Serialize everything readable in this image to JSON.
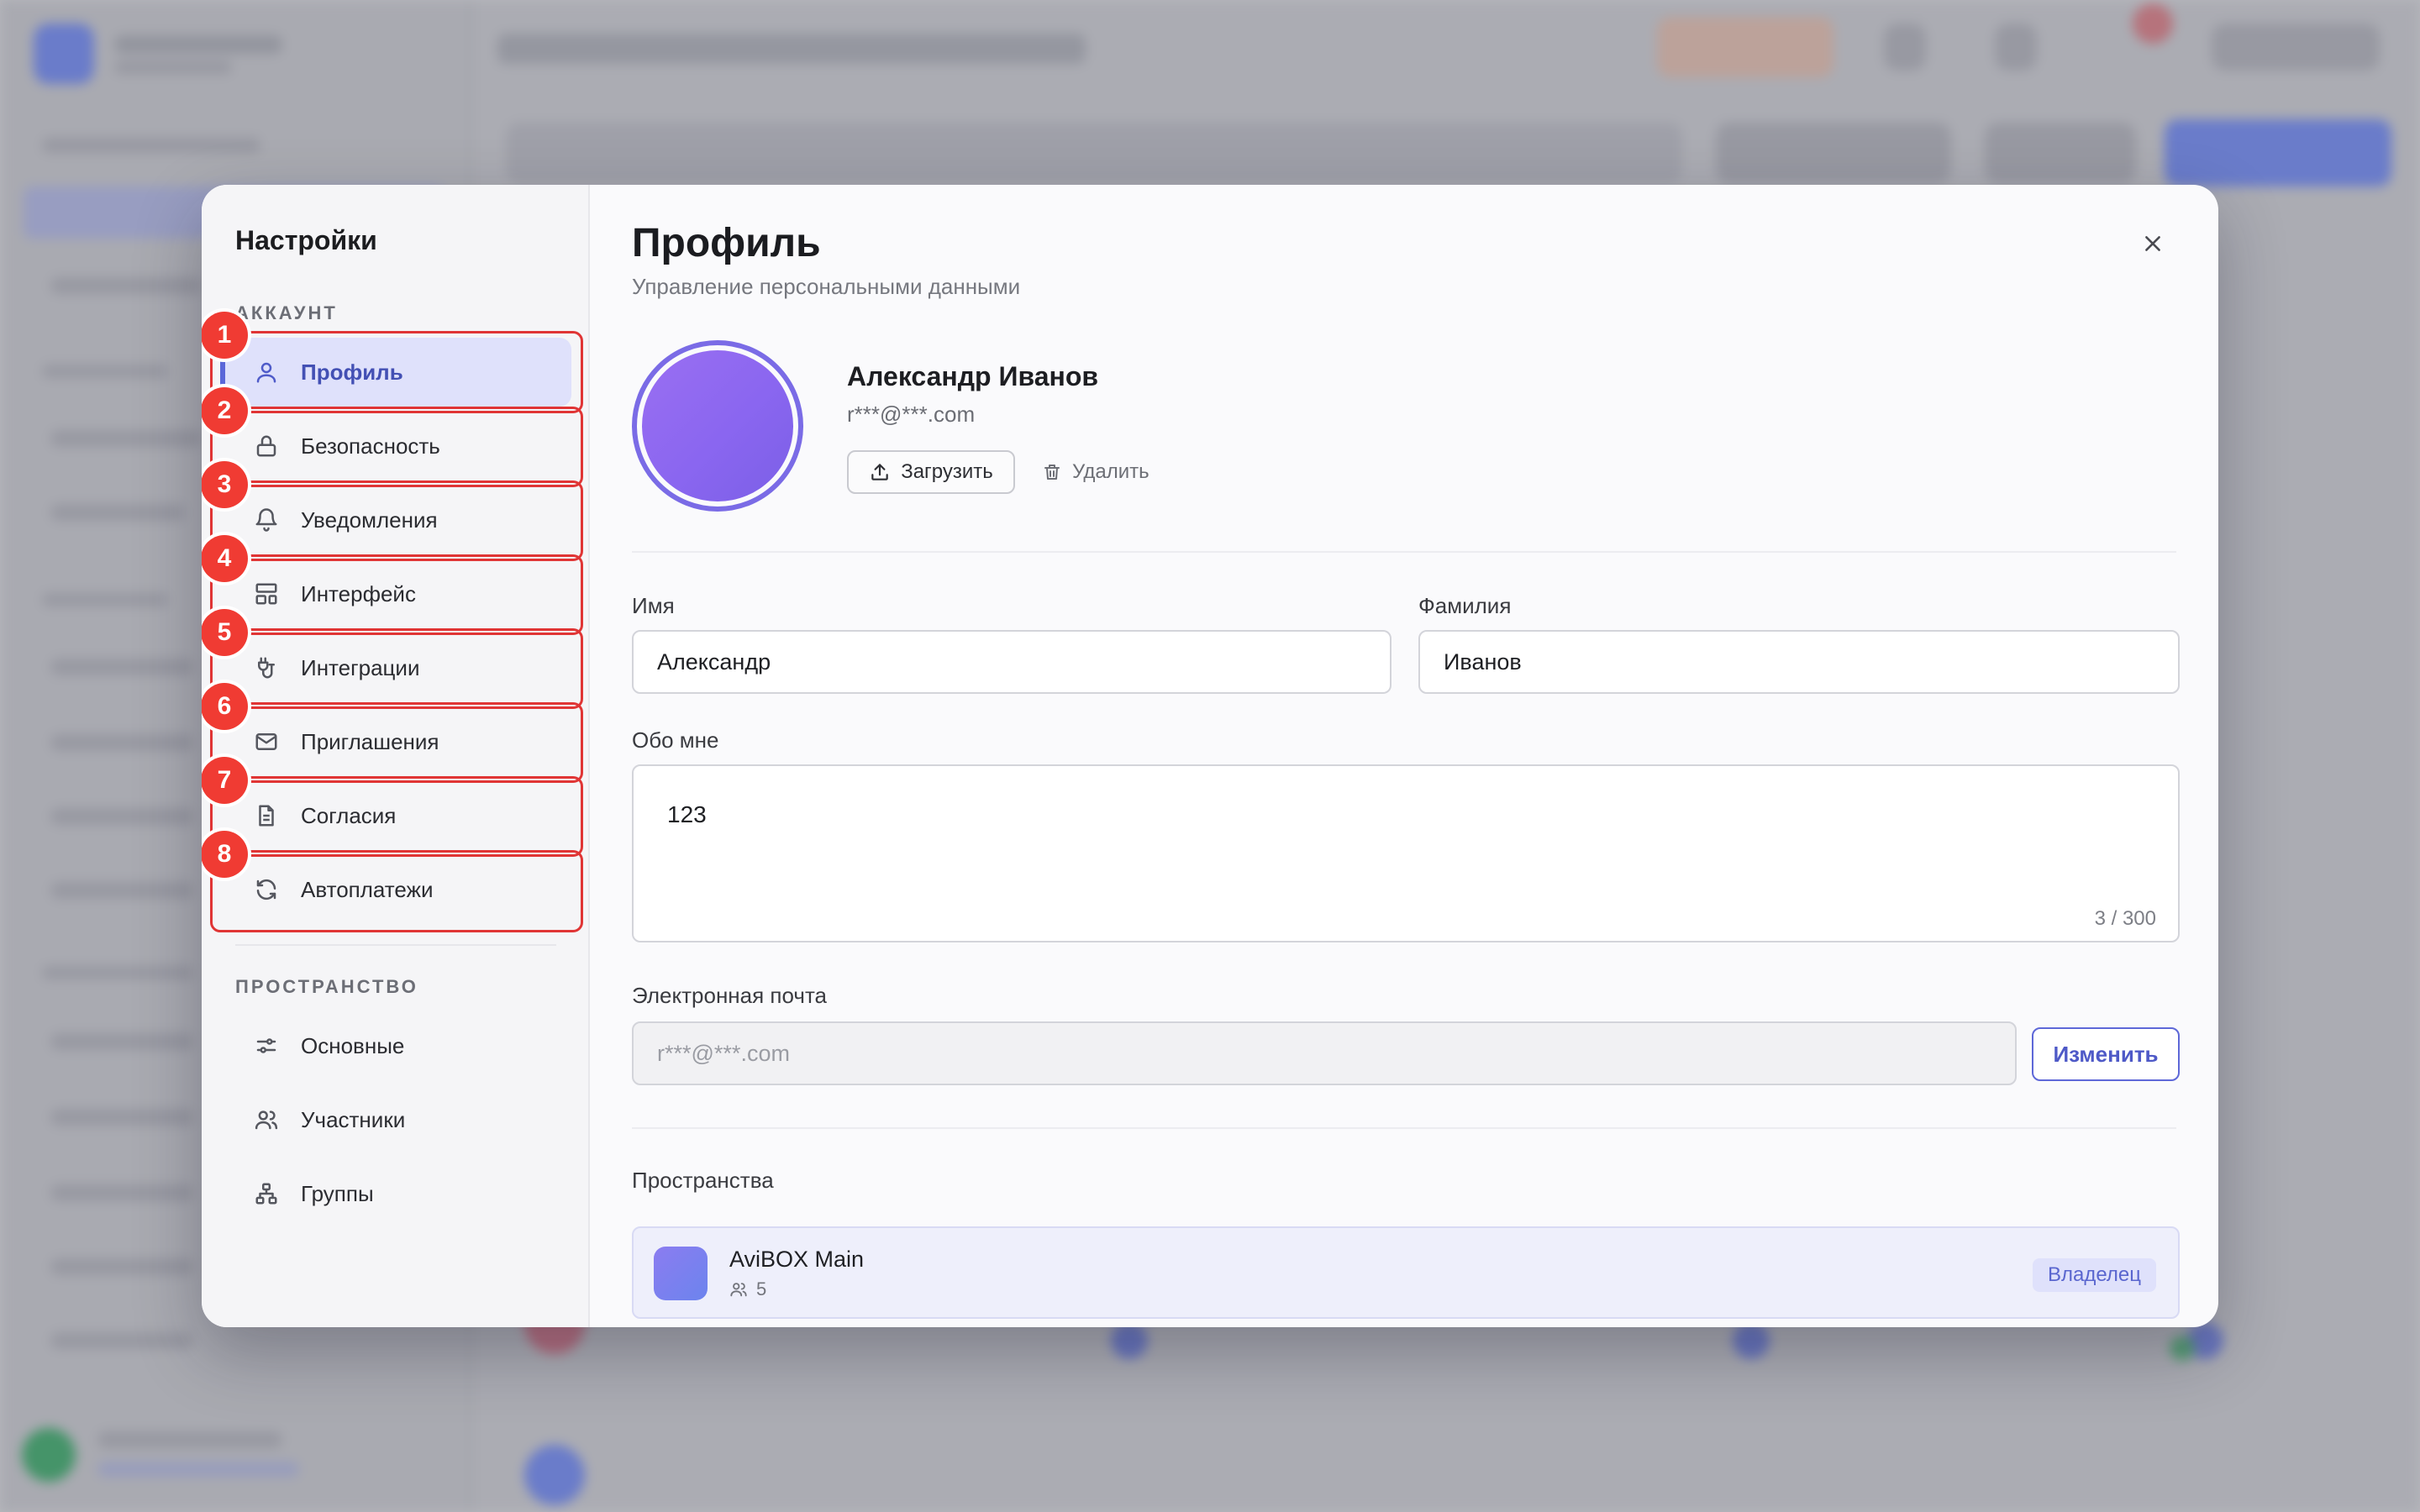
{
  "modal": {
    "nav_title": "Настройки",
    "section_account": "АККАУНТ",
    "section_space": "ПРОСТРАНСТВО",
    "account_items": [
      {
        "label": "Профиль",
        "icon": "user-icon",
        "active": true,
        "marker": "1"
      },
      {
        "label": "Безопасность",
        "icon": "lock-icon",
        "marker": "2"
      },
      {
        "label": "Уведомления",
        "icon": "bell-icon",
        "marker": "3"
      },
      {
        "label": "Интерфейс",
        "icon": "layout-icon",
        "marker": "4"
      },
      {
        "label": "Интеграции",
        "icon": "plug-icon",
        "marker": "5"
      },
      {
        "label": "Приглашения",
        "icon": "mail-icon",
        "marker": "6"
      },
      {
        "label": "Согласия",
        "icon": "document-icon",
        "marker": "7"
      },
      {
        "label": "Автоплатежи",
        "icon": "refresh-icon",
        "marker": "8"
      }
    ],
    "space_items": [
      {
        "label": "Основные",
        "icon": "sliders-icon"
      },
      {
        "label": "Участники",
        "icon": "users-icon"
      },
      {
        "label": "Группы",
        "icon": "hierarchy-icon"
      }
    ]
  },
  "profile": {
    "title": "Профиль",
    "subtitle": "Управление персональными данными",
    "name": "Александр Иванов",
    "email_masked": "r***@***.com",
    "upload_label": "Загрузить",
    "delete_label": "Удалить",
    "first_name_label": "Имя",
    "first_name_value": "Александр",
    "last_name_label": "Фамилия",
    "last_name_value": "Иванов",
    "about_label": "Обо мне",
    "about_value": "123",
    "about_counter": "3 / 300",
    "email_label": "Электронная почта",
    "email_value": "r***@***.com",
    "change_label": "Изменить",
    "spaces_label": "Пространства",
    "space": {
      "name": "AviBOX Main",
      "members": "5",
      "role": "Владелец"
    }
  },
  "colors": {
    "accent": "#5b67d8",
    "active_bg": "#dfe1fb",
    "marker_red": "#f03b33",
    "avatar": "#8a66f0"
  }
}
